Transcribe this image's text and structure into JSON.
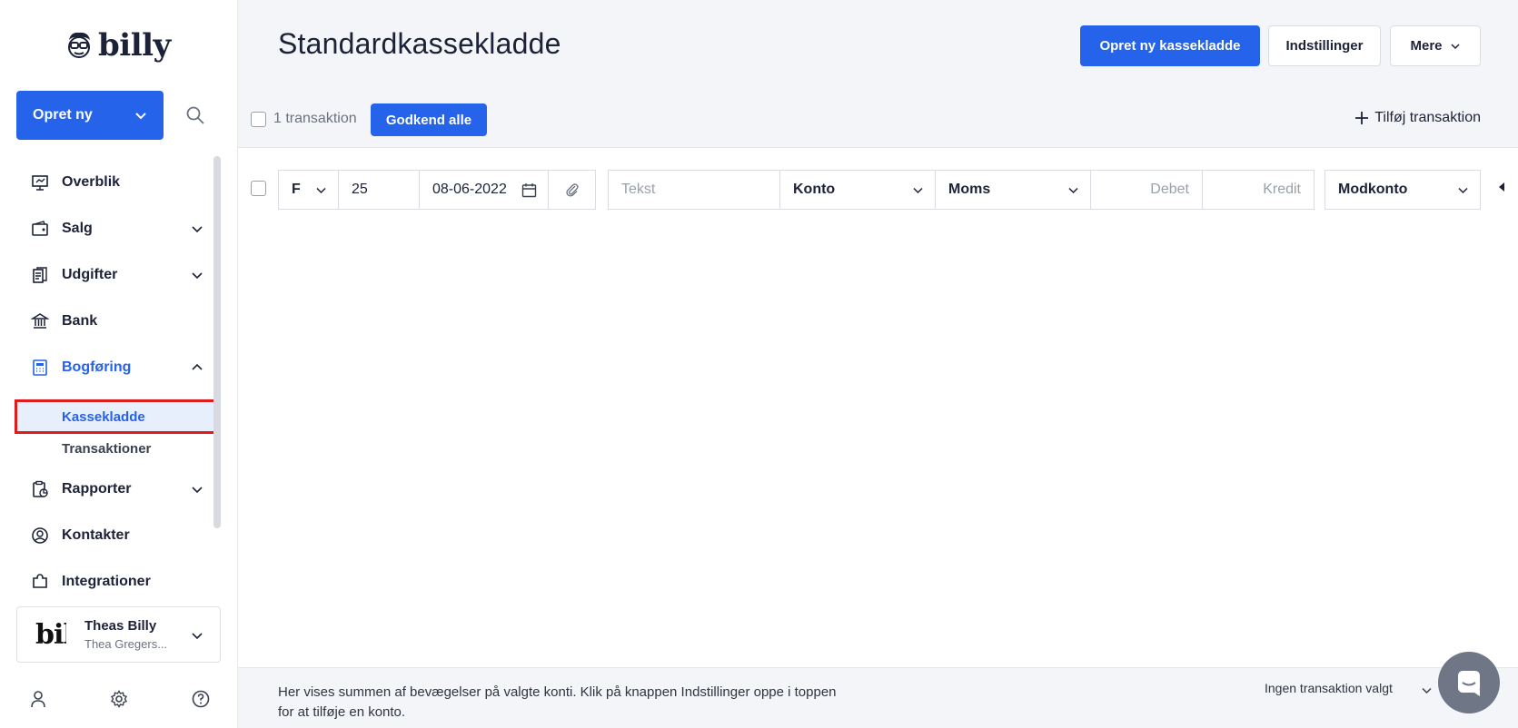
{
  "app": {
    "name": "billy"
  },
  "sidebar": {
    "create_label": "Opret ny",
    "items": [
      {
        "label": "Overblik",
        "icon": "presentation-board-icon",
        "has_chevron": false
      },
      {
        "label": "Salg",
        "icon": "wallet-icon",
        "has_chevron": true
      },
      {
        "label": "Udgifter",
        "icon": "receipts-icon",
        "has_chevron": true
      },
      {
        "label": "Bank",
        "icon": "bank-icon",
        "has_chevron": false
      },
      {
        "label": "Bogføring",
        "icon": "calculator-icon",
        "has_chevron": true,
        "expanded": true
      },
      {
        "label": "Rapporter",
        "icon": "clipboard-chart-icon",
        "has_chevron": true
      },
      {
        "label": "Kontakter",
        "icon": "user-circle-icon",
        "has_chevron": false
      },
      {
        "label": "Integrationer",
        "icon": "puzzle-icon",
        "has_chevron": false
      }
    ],
    "subitems": [
      {
        "label": "Kassekladde",
        "selected": true
      },
      {
        "label": "Transaktioner",
        "selected": false
      }
    ],
    "organization": {
      "logo_text": "billy",
      "name": "Theas Billy",
      "user": "Thea Gregers..."
    }
  },
  "main": {
    "title": "Standardkassekladde",
    "actions": {
      "create": "Opret ny kassekladde",
      "settings": "Indstillinger",
      "more": "Mere"
    },
    "toolbar": {
      "count_label": "1 transaktion",
      "approve_label": "Godkend alle",
      "add_label": "Tilføj transaktion"
    },
    "row": {
      "type": "F",
      "number": "25",
      "date": "08-06-2022",
      "text_placeholder": "Tekst",
      "account": "Konto",
      "vat": "Moms",
      "debit_placeholder": "Debet",
      "credit_placeholder": "Kredit",
      "contra_account": "Modkonto"
    }
  },
  "footer": {
    "text": "Her vises summen af bevægelser på valgte konti. Klik på knappen Indstillinger oppe i toppen for at tilføje en konto.",
    "status": "Ingen transaktion valgt"
  },
  "colors": {
    "accent": "#2563eb",
    "highlight_border": "#e01b1b",
    "selected_bg": "#e8effc"
  }
}
